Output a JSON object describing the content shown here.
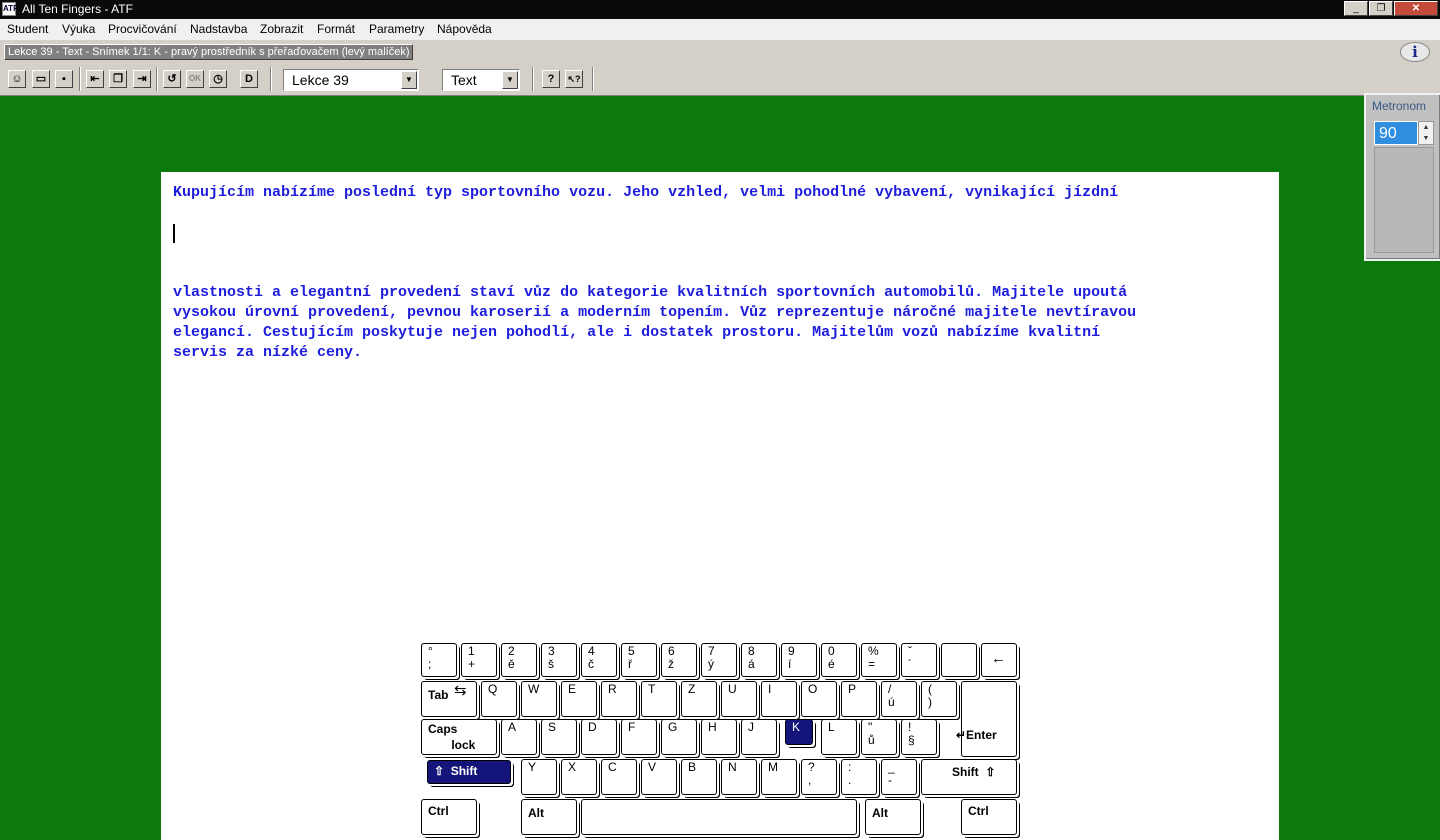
{
  "window": {
    "title": "All Ten Fingers - ATF",
    "app_icon": "ATF",
    "controls": [
      "_",
      "❐",
      "✕"
    ]
  },
  "menu": [
    "Student",
    "Výuka",
    "Procvičování",
    "Nadstavba",
    "Zobrazit",
    "Formát",
    "Parametry",
    "Nápověda"
  ],
  "info_bar": {
    "status": "Lekce 39 - Text - Snímek 1/1:        K - pravý prostředník s přeřaďovačem (levý malíček)",
    "help_icon": "i"
  },
  "toolbar": {
    "lesson_select": "Lekce 39",
    "mode_select": "Text",
    "button_icons": [
      "student-icon",
      "open-icon",
      "save-icon",
      "prev-icon",
      "copy-icon",
      "next-icon",
      "restart-icon",
      "ok-icon",
      "timer-icon",
      "d-icon",
      "help-icon",
      "context-help-icon"
    ],
    "button_glyphs": [
      "☺",
      "▭",
      "▪",
      "⇤",
      "❐",
      "⇥",
      "↺",
      "OK",
      "◷",
      "D",
      "?",
      "↖?"
    ]
  },
  "metronome": {
    "title": "Metronom",
    "value": "90",
    "spin_glyphs": [
      "▲",
      "▼"
    ]
  },
  "document": {
    "line1": "Kupujícím nabízíme poslední typ sportovního vozu. Jeho vzhled, velmi pohodlné vybavení, vynikající jízdní",
    "line2": "vlastnosti a elegantní provedení staví vůz do kategorie kvalitních sportovních automobilů. Majitele upoutá",
    "line3": "vysokou úrovní provedení, pevnou karoserií a moderním topením. Vůz reprezentuje náročné majitele nevtíravou",
    "line4": "elegancí. Cestujícím poskytuje nejen pohodlí, ale i dostatek prostoru. Majitelům vozů nabízíme kvalitní",
    "line5": "servis za nízké ceny."
  },
  "keyboard": {
    "highlighted": [
      "K",
      "Shift"
    ],
    "row1": [
      "°\n;",
      "1\n+",
      "2\ně",
      "3\nš",
      "4\nč",
      "5\nř",
      "6\nž",
      "7\ný",
      "8\ná",
      "9\ní",
      "0\né",
      "%\n=",
      "ˇ\n´",
      "",
      "←"
    ],
    "row2": [
      "Tab",
      "Q",
      "W",
      "E",
      "R",
      "T",
      "Z",
      "U",
      "I",
      "O",
      "P",
      "/\nú",
      "(\n)"
    ],
    "row3": [
      "Caps\n       lock",
      "A",
      "S",
      "D",
      "F",
      "G",
      "H",
      "J",
      "K",
      "L",
      "\"\nů",
      "!\n§",
      "↵Enter"
    ],
    "row4": [
      "⇧  Shift",
      "Y",
      "X",
      "C",
      "V",
      "B",
      "N",
      "M",
      "?\n,",
      ":\n.",
      "_\n-",
      "Shift  ⇧"
    ],
    "row5": [
      "Ctrl",
      "Alt",
      "",
      "Alt",
      "Ctrl"
    ],
    "tab_arrow": "⇆"
  }
}
